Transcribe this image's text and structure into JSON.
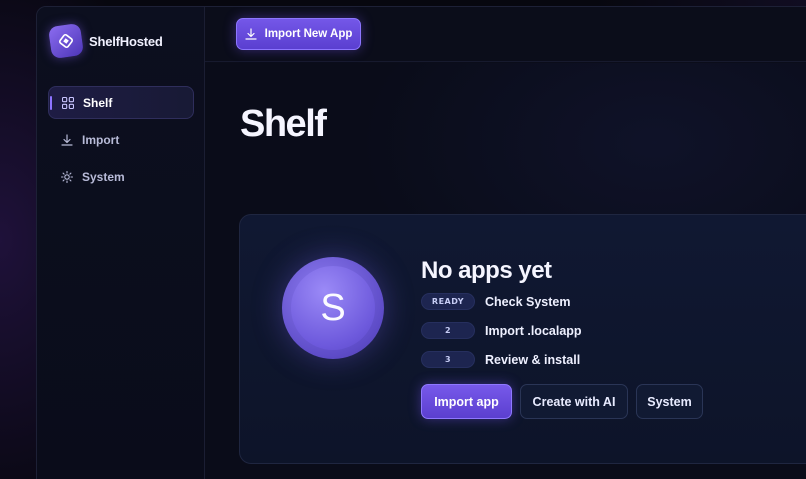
{
  "app": {
    "name": "ShelfHosted",
    "logo_icon": "shelfhosted-logo-icon"
  },
  "sidebar": {
    "items": [
      {
        "label": "Shelf",
        "icon": "grid-icon",
        "active": true
      },
      {
        "label": "Import",
        "icon": "download-icon",
        "active": false
      },
      {
        "label": "System",
        "icon": "gear-icon",
        "active": false
      }
    ]
  },
  "topbar": {
    "import_new_label": "Import New App",
    "import_new_icon": "download-icon"
  },
  "main": {
    "title": "Shelf",
    "empty_state": {
      "avatar_letter": "S",
      "title": "No apps yet",
      "steps": [
        {
          "badge": "READY",
          "label": "Check System"
        },
        {
          "badge": "2",
          "label": "Import .localapp"
        },
        {
          "badge": "3",
          "label": "Review & install"
        }
      ],
      "actions": {
        "import_label": "Import app",
        "create_ai_label": "Create with AI",
        "system_label": "System"
      }
    }
  },
  "colors": {
    "accent": "#6a4fe0",
    "background": "#0a0c19"
  }
}
